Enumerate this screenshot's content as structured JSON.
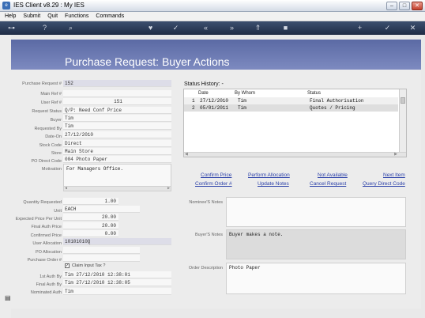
{
  "window": {
    "title": "IES Client v8.29 : My IES",
    "app_icon": "ies-app-icon",
    "buttons": {
      "minimize": "–",
      "maximize": "□",
      "close": "✕"
    }
  },
  "menu": [
    "Help",
    "Submit",
    "Quit",
    "Functions",
    "Commands"
  ],
  "toolbar_icons": [
    {
      "name": "key-icon",
      "glyph": "⊶"
    },
    {
      "name": "help-icon",
      "glyph": "?"
    },
    {
      "name": "search-icon",
      "glyph": "⌕"
    },
    {
      "name": "heart-icon",
      "glyph": "♥"
    },
    {
      "name": "check-circle-icon",
      "glyph": "✓"
    },
    {
      "name": "rewind-icon",
      "glyph": "«"
    },
    {
      "name": "fast-forward-icon",
      "glyph": "»"
    },
    {
      "name": "import-icon",
      "glyph": "⇑"
    },
    {
      "name": "stop-icon",
      "glyph": "■"
    },
    {
      "name": "add-icon",
      "glyph": "+"
    },
    {
      "name": "confirm-icon",
      "glyph": "✓"
    },
    {
      "name": "close-icon",
      "glyph": "✕"
    }
  ],
  "page_title": "Purchase Request: Buyer Actions",
  "form": {
    "purchase_request_label": "Purchase Request #",
    "purchase_request_value": "152",
    "main_ref_label": "Main Ref #",
    "main_ref_value": "",
    "user_ref_label": "User Ref #",
    "user_ref_value": "151",
    "request_status_label": "Request Status",
    "request_status_value": "Q/P: Need Conf Price",
    "buyer_label": "Buyer",
    "buyer_value": "Tim",
    "requested_by_label": "Requested By",
    "requested_by_value": "Tim",
    "date_on_label": "Date-On",
    "date_on_value": "27/12/2010",
    "stock_code_label": "Stock Code",
    "stock_code_value": "Direct",
    "store_label": "Store",
    "store_value": "Main Store",
    "po_direct_code_label": "PO Direct Code",
    "po_direct_code_value": "004 Photo Paper",
    "motivation_label": "Motivation",
    "motivation_value": "For Managers Office.",
    "quantity_label": "Quantity Requested",
    "quantity_value": "1.00",
    "unit_label": "Unit",
    "unit_value": "EACH",
    "expected_price_label": "Expected Price Per Unit",
    "expected_price_value": "20.00",
    "final_auth_price_label": "Final Auth Price",
    "final_auth_price_value": "20.00",
    "confirmed_price_label": "Confirmed Price",
    "confirmed_price_value": "0.00",
    "user_allocation_label": "User Allocation",
    "user_allocation_value": "10101010Q",
    "po_allocation_label": "PO Allocation",
    "po_allocation_value": "",
    "purchase_order_label": "Purchase Order #",
    "purchase_order_value": "",
    "claim_input_tax_label": "Claim Input Tax ?",
    "claim_input_tax_checked": "✓",
    "first_auth_label": "1st Auth By",
    "first_auth_value": "Tim 27/12/2010 12:38:01",
    "final_auth_by_label": "Final Auth By",
    "final_auth_by_value": "Tim 27/12/2010 12:38:05",
    "nominated_auth_label": "Nominated Auth",
    "nominated_auth_value": "Tim"
  },
  "status_history": {
    "title": "Status History: -",
    "headers": [
      "Date",
      "By Whom",
      "Status"
    ],
    "rows": [
      {
        "n": "1",
        "date": "27/12/2010",
        "by": "Tim",
        "status": "Final Authorisation"
      },
      {
        "n": "2",
        "date": "05/01/2011",
        "by": "Tim",
        "status": "Quotes / Pricing"
      }
    ]
  },
  "actions": {
    "confirm_price": "Confirm Price",
    "perform_allocation": "Perform Allocation",
    "not_available": "Not Available",
    "next_item": "Next Item",
    "confirm_order": "Confirm Order #",
    "update_notes": "Update Notes",
    "cancel_request": "Cancel Request",
    "query_direct_code": "Query Direct Code"
  },
  "notes": {
    "nominee_label": "Nominee'S Notes",
    "nominee_value": "",
    "buyer_label": "Buyer'S Notes",
    "buyer_value": "Buyer makes a note.",
    "order_desc_label": "Order Description",
    "order_desc_value": "Photo Paper"
  },
  "colors": {
    "banner": "#6d7ab3",
    "toolbar": "#2b3a58",
    "link": "#2a3fa8"
  }
}
